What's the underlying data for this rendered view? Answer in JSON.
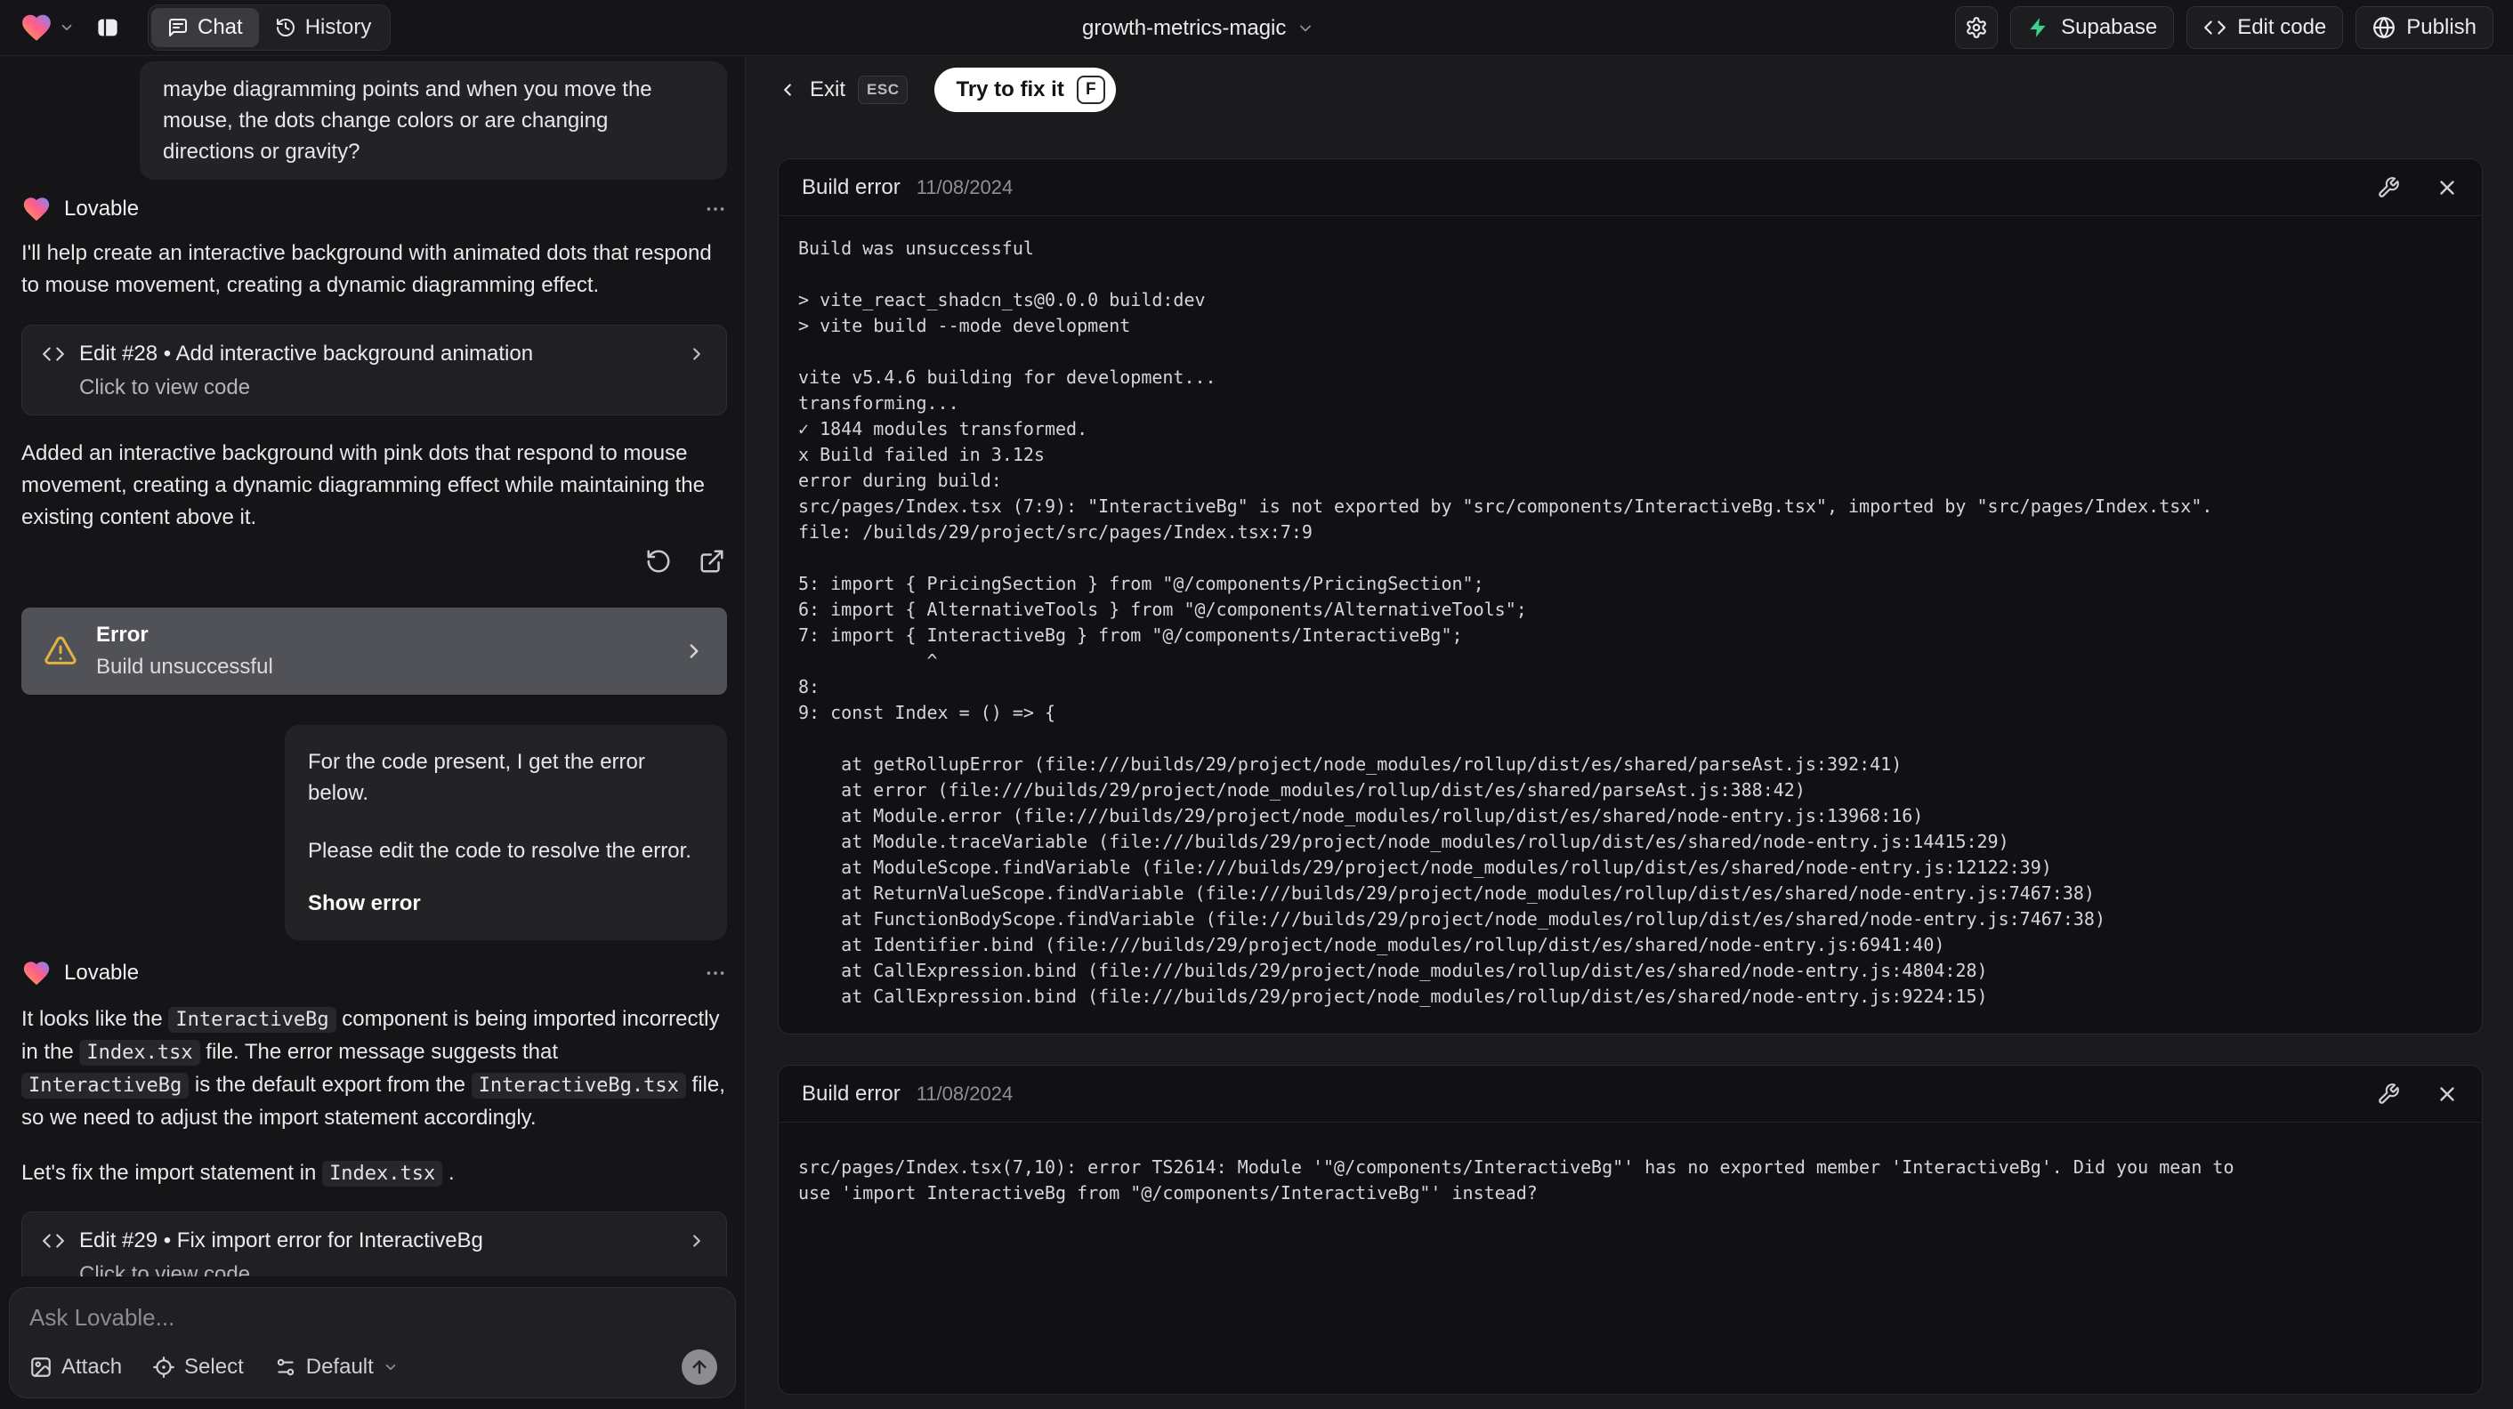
{
  "topbar": {
    "project_name": "growth-metrics-magic",
    "tabs": [
      {
        "label": "Chat"
      },
      {
        "label": "History"
      }
    ],
    "supabase_label": "Supabase",
    "edit_code_label": "Edit code",
    "publish_label": "Publish"
  },
  "chat": {
    "user_message_1": "maybe diagramming points and when you move the mouse, the dots change colors or are changing directions or gravity?",
    "assistant_name": "Lovable",
    "intro": "I'll help create an interactive background with animated dots that respond to mouse movement, creating a dynamic diagramming effect.",
    "edit_card_1": {
      "title": "Edit #28 • Add interactive background animation",
      "subtitle": "Click to view code"
    },
    "result": "Added an interactive background with pink dots that respond to mouse movement, creating a dynamic diagramming effect while maintaining the existing content above it.",
    "error_card": {
      "title": "Error",
      "subtitle": "Build unsuccessful"
    },
    "user_message_2": {
      "p1": "For the code present, I get the error below.",
      "p2": "Please edit the code to resolve the error.",
      "action": "Show error"
    },
    "fix_message": {
      "p1": {
        "s0": "It looks like the ",
        "c0": "InteractiveBg",
        "s1": " component is being imported incorrectly in the ",
        "c1": "Index.tsx",
        "s2": " file. The error message suggests that ",
        "c2": "InteractiveBg",
        "s3": " is the default export from the ",
        "c3": "InteractiveBg.tsx",
        "s4": " file, so we need to adjust the import statement accordingly."
      },
      "p2": {
        "s0": "Let's fix the import statement in ",
        "c0": "Index.tsx",
        "s1": " ."
      }
    },
    "edit_card_2": {
      "title": "Edit #29 • Fix import error for InteractiveBg",
      "subtitle": "Click to view code"
    },
    "composer": {
      "placeholder": "Ask Lovable...",
      "attach_label": "Attach",
      "select_label": "Select",
      "model_label": "Default"
    }
  },
  "fix_bar": {
    "exit_label": "Exit",
    "esc_key": "ESC",
    "fix_label": "Try to fix it",
    "fix_key": "F"
  },
  "error_panels": [
    {
      "title": "Build error",
      "date": "11/08/2024",
      "log": "Build was unsuccessful\n\n> vite_react_shadcn_ts@0.0.0 build:dev\n> vite build --mode development\n\nvite v5.4.6 building for development...\ntransforming...\n✓ 1844 modules transformed.\nx Build failed in 3.12s\nerror during build:\nsrc/pages/Index.tsx (7:9): \"InteractiveBg\" is not exported by \"src/components/InteractiveBg.tsx\", imported by \"src/pages/Index.tsx\".\nfile: /builds/29/project/src/pages/Index.tsx:7:9\n\n5: import { PricingSection } from \"@/components/PricingSection\";\n6: import { AlternativeTools } from \"@/components/AlternativeTools\";\n7: import { InteractiveBg } from \"@/components/InteractiveBg\";\n            ^\n8:\n9: const Index = () => {\n\n    at getRollupError (file:///builds/29/project/node_modules/rollup/dist/es/shared/parseAst.js:392:41)\n    at error (file:///builds/29/project/node_modules/rollup/dist/es/shared/parseAst.js:388:42)\n    at Module.error (file:///builds/29/project/node_modules/rollup/dist/es/shared/node-entry.js:13968:16)\n    at Module.traceVariable (file:///builds/29/project/node_modules/rollup/dist/es/shared/node-entry.js:14415:29)\n    at ModuleScope.findVariable (file:///builds/29/project/node_modules/rollup/dist/es/shared/node-entry.js:12122:39)\n    at ReturnValueScope.findVariable (file:///builds/29/project/node_modules/rollup/dist/es/shared/node-entry.js:7467:38)\n    at FunctionBodyScope.findVariable (file:///builds/29/project/node_modules/rollup/dist/es/shared/node-entry.js:7467:38)\n    at Identifier.bind (file:///builds/29/project/node_modules/rollup/dist/es/shared/node-entry.js:6941:40)\n    at CallExpression.bind (file:///builds/29/project/node_modules/rollup/dist/es/shared/node-entry.js:4804:28)\n    at CallExpression.bind (file:///builds/29/project/node_modules/rollup/dist/es/shared/node-entry.js:9224:15)"
    },
    {
      "title": "Build error",
      "date": "11/08/2024",
      "log": "src/pages/Index.tsx(7,10): error TS2614: Module '\"@/components/InteractiveBg\"' has no exported member 'InteractiveBg'. Did you mean to use 'import InteractiveBg from \"@/components/InteractiveBg\"' instead?"
    }
  ],
  "colors": {
    "supabase_green": "#3ecf8e",
    "warning_amber": "#e3b341",
    "heart_gradient": [
      "#ffa351",
      "#ff5c8a",
      "#7b87ff"
    ]
  }
}
